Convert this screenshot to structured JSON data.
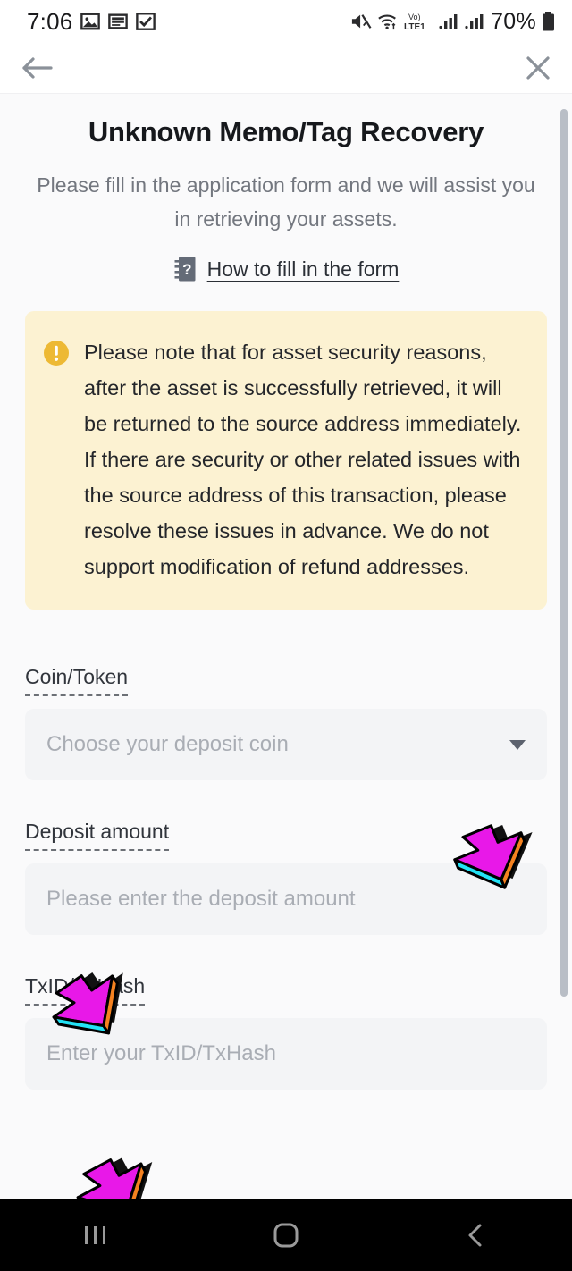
{
  "status_bar": {
    "time": "7:06",
    "left_icons": [
      "gallery-icon",
      "news-list-icon",
      "checkbox-checked-icon"
    ],
    "right_icons": [
      "mute-icon",
      "wifi-icon",
      "volte-lte1-icon",
      "signal-bars-icon",
      "signal-bars-2-icon"
    ],
    "network_label": "Vo)",
    "network_sub": "LTE1",
    "battery_percent": "70%"
  },
  "app_bar": {
    "back_icon": "arrow-left-icon",
    "close_icon": "close-icon"
  },
  "page": {
    "title": "Unknown Memo/Tag Recovery",
    "subtitle": "Please fill in the application form and we will assist you in retrieving your assets.",
    "help_link": "How to fill in the form",
    "help_icon": "guide-book-question-icon"
  },
  "warning": {
    "icon": "exclamation-circle-icon",
    "text": "Please note that for asset security reasons, after the asset is successfully retrieved, it will be returned to the source address immediately. If there are security or other related issues with the source address of this transaction, please resolve these issues in advance. We do not support modification of refund addresses.",
    "background": "#fcf2d2",
    "icon_color": "#edb934"
  },
  "form": {
    "fields": [
      {
        "label": "Coin/Token",
        "placeholder": "Choose your deposit coin",
        "value": "",
        "type": "select",
        "caret_icon": "chevron-down-icon"
      },
      {
        "label": "Deposit amount",
        "placeholder": "Please enter the deposit amount",
        "value": "",
        "type": "text"
      },
      {
        "label": "TxID/TxHash",
        "placeholder": "Enter your TxID/TxHash",
        "value": "",
        "type": "text"
      }
    ]
  },
  "nav_bar": {
    "recents": "recents-icon",
    "home": "home-icon",
    "back": "back-icon"
  },
  "colors": {
    "page_bg": "#fafafb",
    "input_bg": "#f3f4f6",
    "accent_warning": "#edb934",
    "cursor_magenta": "#e818e8",
    "cursor_cyan": "#22e2f5",
    "cursor_orange": "#f58220"
  }
}
